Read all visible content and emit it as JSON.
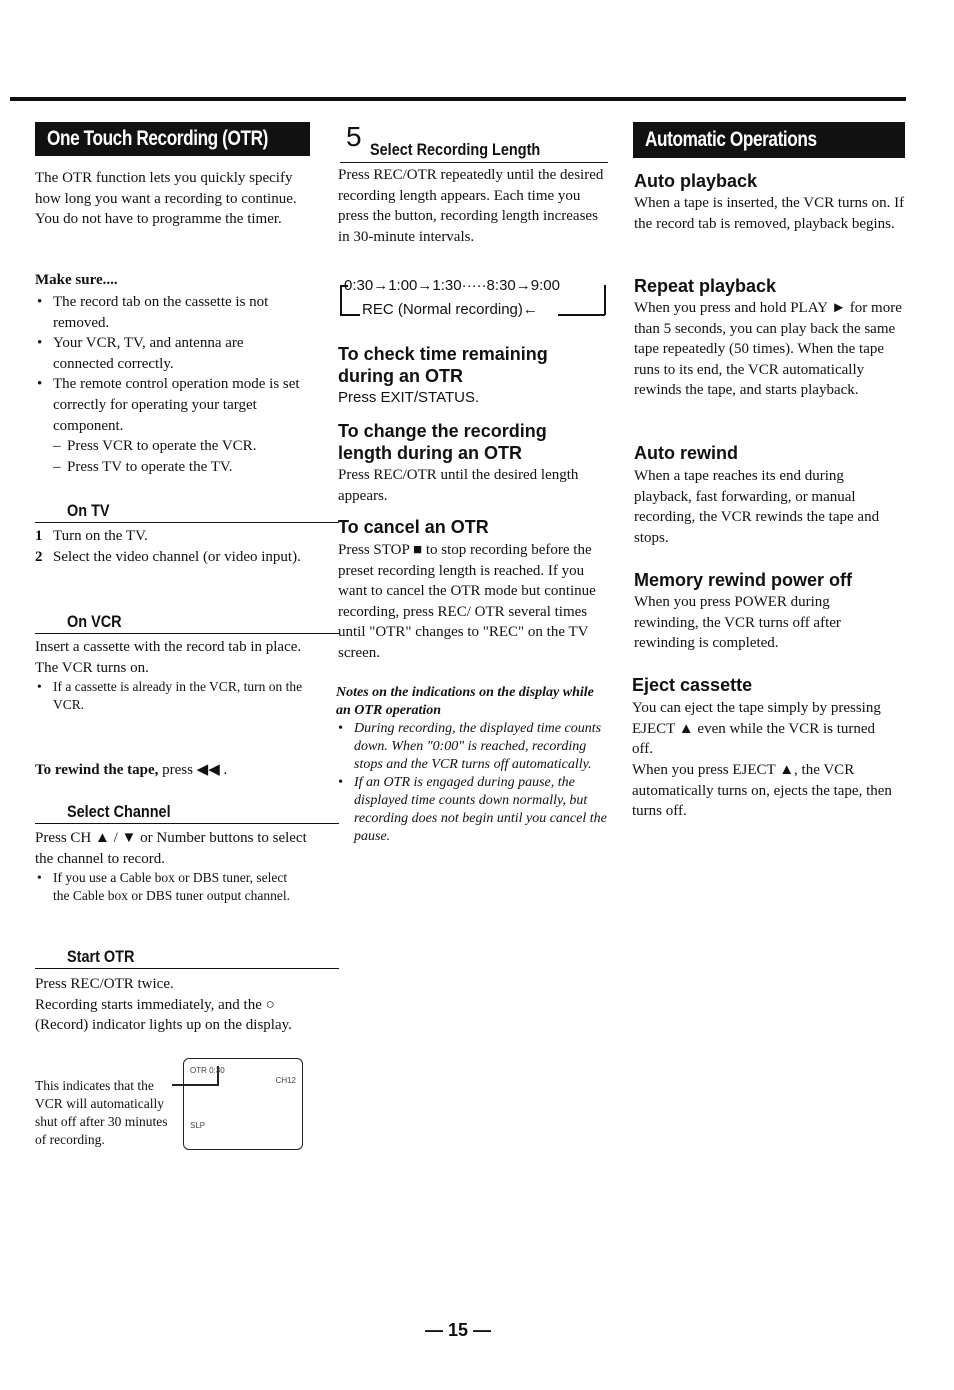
{
  "left": {
    "banner": "One Touch Recording (OTR)",
    "intro": "The OTR function lets you quickly specify how long you want a recording to continue. You do not have to programme the timer.",
    "make_sure_title": "Make sure....",
    "make_sure": [
      "The record tab on the cassette is not removed.",
      "Your VCR, TV, and antenna are connected correctly.",
      "The remote control operation mode is set correctly for operating your target component."
    ],
    "sub": [
      "Press VCR to operate the VCR.",
      "Press TV to operate the TV."
    ],
    "on_tv": {
      "title": "On TV",
      "steps": [
        {
          "n": "1",
          "text": "Turn on the TV."
        },
        {
          "n": "2",
          "text": "Select the video channel (or video input)."
        }
      ]
    },
    "on_vcr": {
      "title": "On VCR",
      "text1": "Insert a cassette with the record tab in place.",
      "text2": "The VCR turns on.",
      "bullet": "If a cassette is already in the VCR, turn on the VCR."
    },
    "rewind": {
      "bold": "To rewind the tape,",
      "rest": "press ◀◀ ."
    },
    "select_channel": {
      "title": "Select Channel",
      "text": "Press CH ▲ / ▼ or Number buttons to select the channel to record.",
      "bullet": "If you use a Cable box or DBS tuner, select the Cable box or DBS tuner output channel."
    },
    "start_otr": {
      "title": "Start OTR",
      "text1": "Press REC/OTR twice.",
      "text2": "Recording starts immediately, and the ○ (Record) indicator lights up on the display.",
      "callout": "This indicates that the VCR will automatically shut off after 30 minutes of recording.",
      "display": {
        "otr": "OTR 0:30",
        "ch": "CH12",
        "mode": "SLP"
      }
    }
  },
  "middle": {
    "step_number": "5",
    "title": "Select Recording Length",
    "text": "Press REC/OTR repeatedly until the desired recording length appears. Each time you press the button, recording length increases in 30-minute intervals.",
    "sequence": "0:30→1:00→1:30·····8:30→9:00",
    "sequence_return": "REC (Normal recording)←",
    "check": {
      "title": "To check time remaining during an OTR",
      "text": "Press EXIT/STATUS."
    },
    "change": {
      "title": "To change the recording length during an OTR",
      "text": "Press REC/OTR until the desired length appears."
    },
    "cancel": {
      "title": "To cancel an OTR",
      "text": "Press STOP ■ to stop recording before the preset recording length is reached. If you want to cancel the OTR mode but continue recording, press REC/ OTR several times until \"OTR\" changes to \"REC\" on the TV screen."
    },
    "notes": {
      "title": "Notes on the indications on the display while an OTR operation",
      "items": [
        "During recording, the displayed time counts down. When \"0:00\" is reached, recording stops and the VCR turns off automatically.",
        "If an OTR is engaged during pause, the displayed time counts down normally, but recording does not begin until you cancel the pause."
      ]
    }
  },
  "right": {
    "banner": "Automatic Operations",
    "sections": [
      {
        "title": "Auto playback",
        "text": "When a tape is inserted, the VCR turns on. If the record tab is removed, playback begins."
      },
      {
        "title": "Repeat playback",
        "text": "When you press and hold PLAY ► for more than 5 seconds, you can play back the same tape repeatedly (50 times). When the tape runs to its end, the VCR automatically rewinds the tape, and starts playback."
      },
      {
        "title": "Auto rewind",
        "text": "When a tape reaches its end during playback, fast forwarding, or manual recording, the VCR rewinds the tape and stops."
      },
      {
        "title": "Memory rewind power off",
        "text": "When you press POWER during rewinding, the VCR turns off after rewinding is completed."
      },
      {
        "title": "Eject cassette",
        "text": "You can eject the tape simply by pressing EJECT ▲ even while the VCR is turned off.",
        "text2": "When you press EJECT ▲, the VCR automatically turns on, ejects the tape, then turns off."
      }
    ]
  },
  "page_number": "— 15 —"
}
